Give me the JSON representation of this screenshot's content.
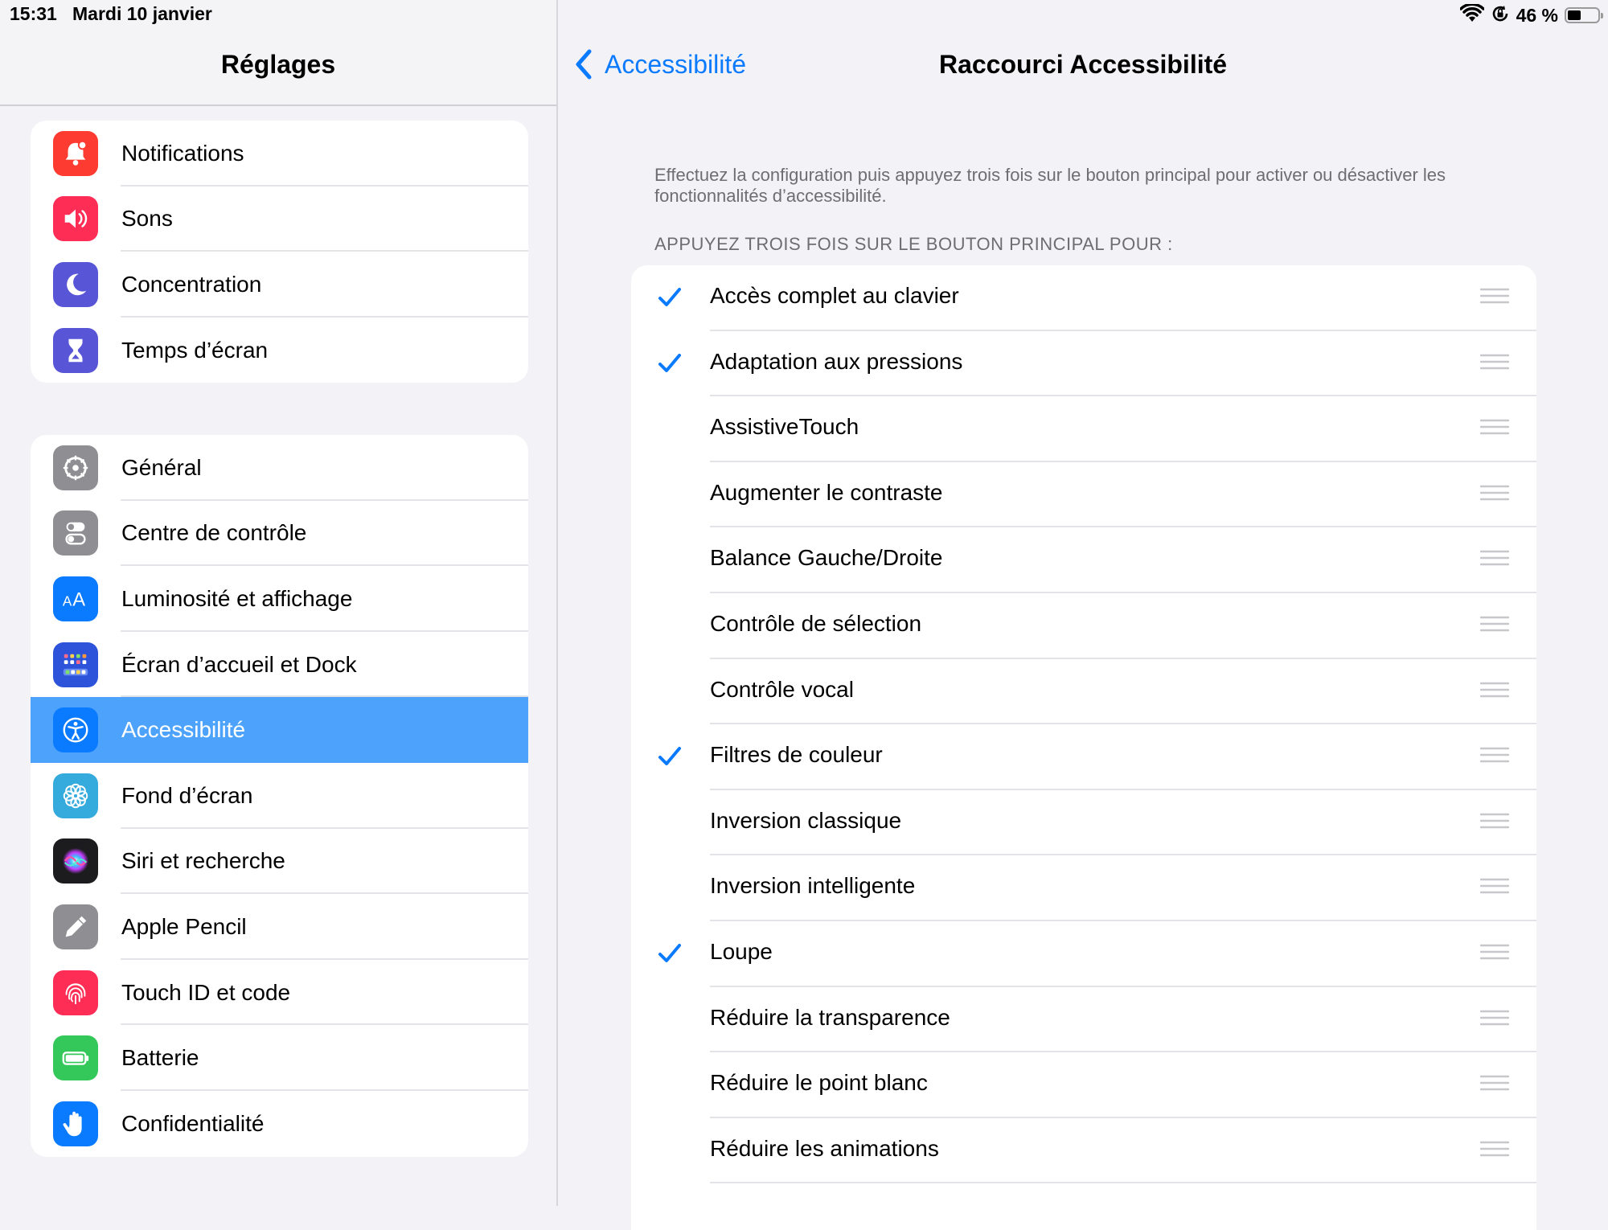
{
  "status_bar": {
    "time": "15:31",
    "date": "Mardi 10 janvier",
    "battery": "46 %",
    "icons": [
      "wifi-icon",
      "orientation-lock-icon",
      "battery-icon"
    ]
  },
  "sidebar": {
    "title": "Réglages",
    "groups": [
      [
        {
          "label": "Notifications",
          "icon": "bell-icon",
          "color": "#fe3b30"
        },
        {
          "label": "Sons",
          "icon": "speaker-icon",
          "color": "#fe2d55"
        },
        {
          "label": "Concentration",
          "icon": "moon-icon",
          "color": "#5856d6"
        },
        {
          "label": "Temps d’écran",
          "icon": "hourglass-icon",
          "color": "#5856d6"
        }
      ],
      [
        {
          "label": "Général",
          "icon": "gear-icon",
          "color": "#8e8e93"
        },
        {
          "label": "Centre de contrôle",
          "icon": "toggles-icon",
          "color": "#8e8e93"
        },
        {
          "label": "Luminosité et affichage",
          "icon": "text-size-icon",
          "color": "#0a7aff"
        },
        {
          "label": "Écran d’accueil et Dock",
          "icon": "home-grid-icon",
          "color": "#2c53d9"
        },
        {
          "label": "Accessibilité",
          "icon": "accessibility-icon",
          "color": "#0a7aff",
          "selected": true
        },
        {
          "label": "Fond d’écran",
          "icon": "flower-icon",
          "color": "#35aadc"
        },
        {
          "label": "Siri et recherche",
          "icon": "siri-icon",
          "color": "#1c1c1e"
        },
        {
          "label": "Apple Pencil",
          "icon": "pencil-icon",
          "color": "#8e8e93"
        },
        {
          "label": "Touch ID et code",
          "icon": "fingerprint-icon",
          "color": "#fe2d55"
        },
        {
          "label": "Batterie",
          "icon": "battery-icon",
          "color": "#34c759"
        },
        {
          "label": "Confidentialité",
          "icon": "hand-icon",
          "color": "#0a7aff"
        }
      ]
    ]
  },
  "detail": {
    "back_label": "Accessibilité",
    "title": "Raccourci Accessibilité",
    "description": "Effectuez la configuration puis appuyez trois fois sur le bouton principal pour activer ou désactiver les fonctionnalités d’accessibilité.",
    "section_header": "APPUYEZ TROIS FOIS SUR LE BOUTON PRINCIPAL POUR :",
    "items": [
      {
        "label": "Accès complet au clavier",
        "checked": true
      },
      {
        "label": "Adaptation aux pressions",
        "checked": true
      },
      {
        "label": "AssistiveTouch",
        "checked": false
      },
      {
        "label": "Augmenter le contraste",
        "checked": false
      },
      {
        "label": "Balance Gauche/Droite",
        "checked": false
      },
      {
        "label": "Contrôle de sélection",
        "checked": false
      },
      {
        "label": "Contrôle vocal",
        "checked": false
      },
      {
        "label": "Filtres de couleur",
        "checked": true
      },
      {
        "label": "Inversion classique",
        "checked": false
      },
      {
        "label": "Inversion intelligente",
        "checked": false
      },
      {
        "label": "Loupe",
        "checked": true
      },
      {
        "label": "Réduire la transparence",
        "checked": false
      },
      {
        "label": "Réduire le point blanc",
        "checked": false
      },
      {
        "label": "Réduire les animations",
        "checked": false
      }
    ]
  },
  "colors": {
    "accent": "#0a7aff",
    "selected_row": "#4da3fb",
    "background": "#f2f2f7",
    "secondary_text": "#6d6d72"
  }
}
